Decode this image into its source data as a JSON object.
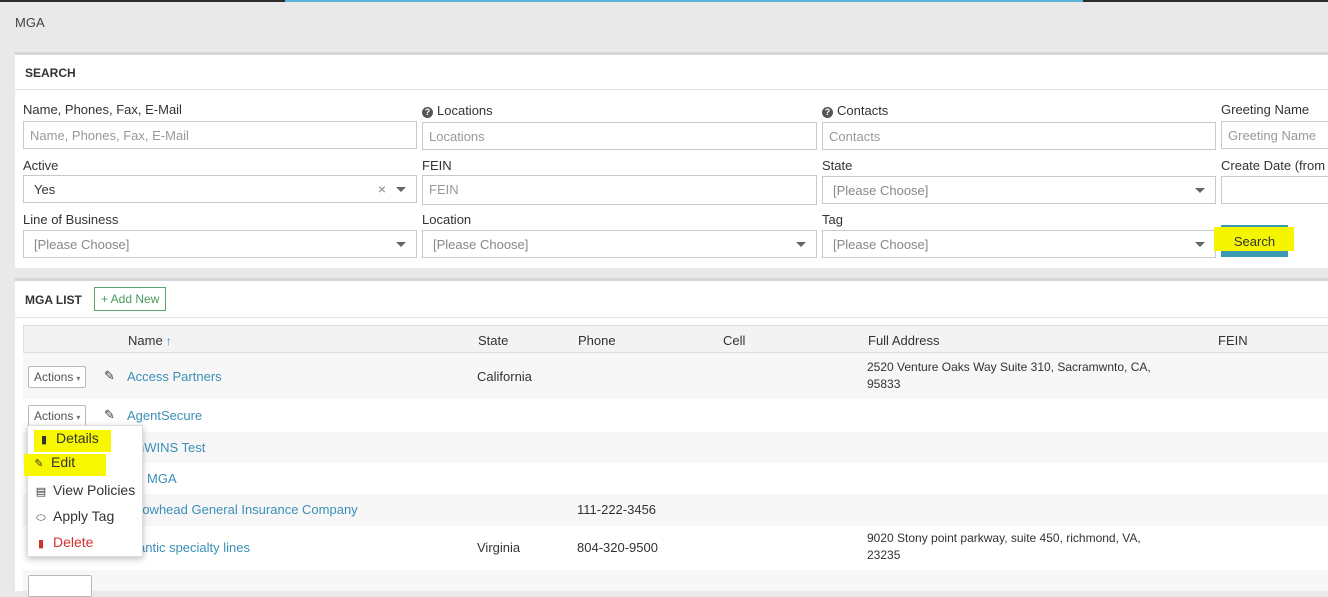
{
  "page": {
    "title": "MGA"
  },
  "search": {
    "title": "SEARCH",
    "fields": {
      "name_phones": {
        "label": "Name, Phones, Fax, E-Mail",
        "placeholder": "Name, Phones, Fax, E-Mail"
      },
      "locations": {
        "label": "Locations",
        "placeholder": "Locations"
      },
      "contacts": {
        "label": "Contacts",
        "placeholder": "Contacts"
      },
      "greeting": {
        "label": "Greeting Name",
        "placeholder": "Greeting Name"
      },
      "active": {
        "label": "Active",
        "value": "Yes",
        "clear": "×"
      },
      "fein": {
        "label": "FEIN",
        "placeholder": "FEIN"
      },
      "state": {
        "label": "State",
        "value": "[Please Choose]"
      },
      "create_date": {
        "label": "Create Date (from"
      },
      "line_of_business": {
        "label": "Line of Business",
        "value": "[Please Choose]"
      },
      "location": {
        "label": "Location",
        "value": "[Please Choose]"
      },
      "tag": {
        "label": "Tag",
        "value": "[Please Choose]"
      }
    },
    "search_button": "Search",
    "help_glyph": "?"
  },
  "list": {
    "title": "MGA LIST",
    "add_new": "+ Add New",
    "columns": {
      "name": "Name",
      "sort_glyph": "↑",
      "state": "State",
      "phone": "Phone",
      "cell": "Cell",
      "address": "Full Address",
      "fein": "FEIN"
    },
    "actions_label": "Actions",
    "rows": [
      {
        "name": "Access Partners",
        "state": "California",
        "phone": "",
        "cell": "",
        "address_1": "2520 Venture Oaks Way Suite 310, Sacramwnto, CA,",
        "address_2": "95833",
        "fein": ""
      },
      {
        "name": "AgentSecure",
        "state": "",
        "phone": "",
        "cell": "",
        "address_1": "",
        "address_2": "",
        "fein": ""
      },
      {
        "name": "nWINS Test",
        "state": "",
        "phone": "",
        "cell": "",
        "address_1": "",
        "address_2": "",
        "fein": ""
      },
      {
        "name": "MGA",
        "state": "",
        "phone": "",
        "cell": "",
        "address_1": "",
        "address_2": "",
        "fein": ""
      },
      {
        "name": "rowhead General Insurance Company",
        "state": "",
        "phone": "111-222-3456",
        "cell": "",
        "address_1": "",
        "address_2": "",
        "fein": ""
      },
      {
        "name": "antic specialty lines",
        "state": "Virginia",
        "phone": "804-320-9500",
        "cell": "",
        "address_1": "9020 Stony point parkway, suite 450, richmond, VA,",
        "address_2": "23235",
        "fein": ""
      }
    ]
  },
  "actions_menu": {
    "items": [
      {
        "label": "Details",
        "icon": "file-icon"
      },
      {
        "label": "Edit",
        "icon": "user-edit-icon"
      },
      {
        "label": "View Policies",
        "icon": "policy-icon"
      },
      {
        "label": "Apply Tag",
        "icon": "tag-icon"
      },
      {
        "label": "Delete",
        "icon": "trash-icon"
      }
    ]
  },
  "colors": {
    "accent": "#3a8fb7",
    "search_button": "#3c9ab0",
    "highlight": "#f7f700",
    "danger": "#d2322d",
    "add_new": "#4a9a5e"
  }
}
